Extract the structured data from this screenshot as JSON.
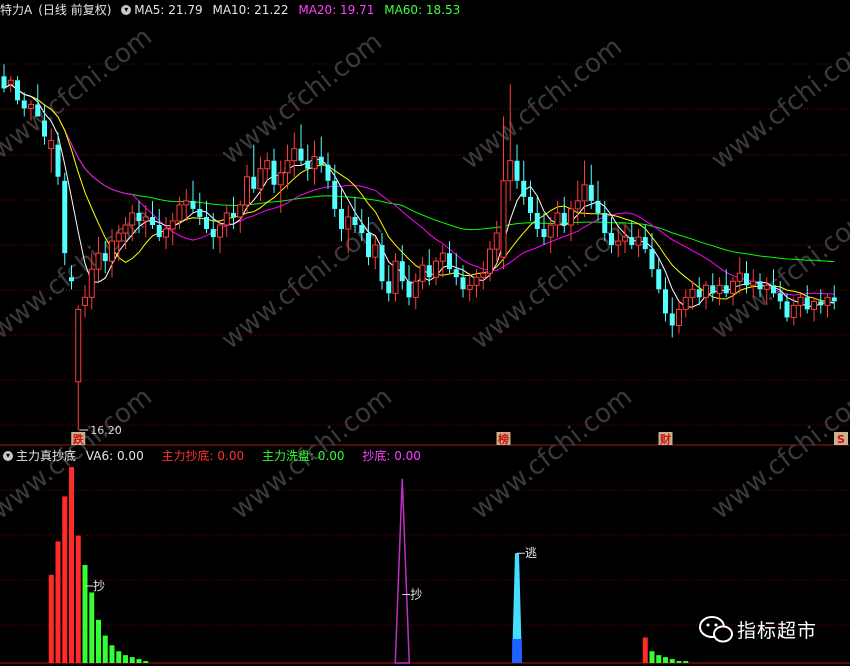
{
  "header_main": {
    "title": "特力A",
    "period": "(日线 前复权)",
    "ma5_label": "MA5: 21.79",
    "ma10_label": "MA10: 21.22",
    "ma20_label": "MA20: 19.71",
    "ma60_label": "MA60: 18.53"
  },
  "header_indicator": {
    "name": "主力真抄底",
    "va6_label": "VA6: 0.00",
    "main_bottom_label": "主力抄底: 0.00",
    "main_wash_label": "主力洗盘: 0.00",
    "bottom_label": "抄底: 0.00"
  },
  "watermark": "www.cfchi.com",
  "brand": {
    "name": "指标超市",
    "icon": "wechat-bubbles-icon"
  },
  "colors": {
    "background": "#000000",
    "up": "#ff3b3b",
    "down": "#54ffff",
    "ma5": "#ffffff",
    "ma10": "#ffff00",
    "ma20": "#ff00ff",
    "ma60": "#00ff00",
    "grid": "#7a0000",
    "indicator_red": "#ff2a2a",
    "indicator_green": "#33ff33",
    "indicator_purple": "#c030c0",
    "indicator_cyan": "#45ddff"
  },
  "chart_data": [
    {
      "type": "candlestick",
      "y_range": [
        16.2,
        26.4
      ],
      "low_annotation": "16.20",
      "markers": [
        {
          "index": 11,
          "text": "跌"
        },
        {
          "index": 74,
          "text": "榜"
        },
        {
          "index": 98,
          "text": "财"
        },
        {
          "index": 124,
          "text": "S"
        }
      ],
      "candles": [
        {
          "o": 25.0,
          "h": 25.3,
          "l": 24.6,
          "c": 24.7
        },
        {
          "o": 24.8,
          "h": 25.0,
          "l": 24.6,
          "c": 24.9
        },
        {
          "o": 24.9,
          "h": 25.0,
          "l": 24.3,
          "c": 24.4
        },
        {
          "o": 24.4,
          "h": 24.6,
          "l": 24.0,
          "c": 24.2
        },
        {
          "o": 24.2,
          "h": 24.4,
          "l": 23.9,
          "c": 24.3
        },
        {
          "o": 24.3,
          "h": 24.8,
          "l": 24.1,
          "c": 24.0
        },
        {
          "o": 23.9,
          "h": 24.3,
          "l": 23.3,
          "c": 23.5
        },
        {
          "o": 23.2,
          "h": 23.7,
          "l": 22.6,
          "c": 23.4
        },
        {
          "o": 23.3,
          "h": 23.6,
          "l": 22.3,
          "c": 22.5
        },
        {
          "o": 22.4,
          "h": 22.6,
          "l": 20.3,
          "c": 20.6
        },
        {
          "o": 20.0,
          "h": 20.3,
          "l": 19.7,
          "c": 19.9
        },
        {
          "o": 17.4,
          "h": 19.3,
          "l": 16.2,
          "c": 19.2
        },
        {
          "o": 19.3,
          "h": 19.8,
          "l": 19.0,
          "c": 19.5
        },
        {
          "o": 19.5,
          "h": 20.6,
          "l": 19.2,
          "c": 20.2
        },
        {
          "o": 20.2,
          "h": 21.0,
          "l": 19.9,
          "c": 20.6
        },
        {
          "o": 20.6,
          "h": 20.9,
          "l": 20.1,
          "c": 20.4
        },
        {
          "o": 20.4,
          "h": 21.2,
          "l": 20.0,
          "c": 20.9
        },
        {
          "o": 20.9,
          "h": 21.3,
          "l": 20.4,
          "c": 21.1
        },
        {
          "o": 21.1,
          "h": 21.5,
          "l": 20.7,
          "c": 21.3
        },
        {
          "o": 21.3,
          "h": 21.8,
          "l": 20.9,
          "c": 21.6
        },
        {
          "o": 21.6,
          "h": 21.9,
          "l": 21.1,
          "c": 21.4
        },
        {
          "o": 21.4,
          "h": 21.8,
          "l": 21.0,
          "c": 21.5
        },
        {
          "o": 21.5,
          "h": 21.9,
          "l": 21.2,
          "c": 21.3
        },
        {
          "o": 21.3,
          "h": 21.7,
          "l": 20.9,
          "c": 21.0
        },
        {
          "o": 21.0,
          "h": 21.5,
          "l": 20.7,
          "c": 21.2
        },
        {
          "o": 21.2,
          "h": 21.6,
          "l": 20.8,
          "c": 21.4
        },
        {
          "o": 21.4,
          "h": 22.0,
          "l": 21.2,
          "c": 21.8
        },
        {
          "o": 21.8,
          "h": 22.2,
          "l": 21.4,
          "c": 21.9
        },
        {
          "o": 21.9,
          "h": 22.4,
          "l": 21.6,
          "c": 21.7
        },
        {
          "o": 21.7,
          "h": 22.1,
          "l": 21.3,
          "c": 21.5
        },
        {
          "o": 21.5,
          "h": 21.9,
          "l": 21.1,
          "c": 21.2
        },
        {
          "o": 21.2,
          "h": 21.6,
          "l": 20.7,
          "c": 21.0
        },
        {
          "o": 21.0,
          "h": 21.4,
          "l": 20.6,
          "c": 21.3
        },
        {
          "o": 21.3,
          "h": 21.8,
          "l": 21.0,
          "c": 21.6
        },
        {
          "o": 21.6,
          "h": 22.0,
          "l": 21.2,
          "c": 21.5
        },
        {
          "o": 21.5,
          "h": 21.9,
          "l": 21.1,
          "c": 21.8
        },
        {
          "o": 21.8,
          "h": 22.8,
          "l": 21.6,
          "c": 22.5
        },
        {
          "o": 22.5,
          "h": 23.3,
          "l": 22.1,
          "c": 22.2
        },
        {
          "o": 22.2,
          "h": 23.0,
          "l": 21.9,
          "c": 22.7
        },
        {
          "o": 22.7,
          "h": 23.1,
          "l": 22.4,
          "c": 22.9
        },
        {
          "o": 22.9,
          "h": 23.2,
          "l": 22.1,
          "c": 22.3
        },
        {
          "o": 22.3,
          "h": 22.9,
          "l": 21.6,
          "c": 22.6
        },
        {
          "o": 22.6,
          "h": 23.3,
          "l": 22.2,
          "c": 22.9
        },
        {
          "o": 22.9,
          "h": 23.6,
          "l": 22.5,
          "c": 23.2
        },
        {
          "o": 23.2,
          "h": 23.8,
          "l": 22.8,
          "c": 22.9
        },
        {
          "o": 22.9,
          "h": 23.3,
          "l": 22.4,
          "c": 22.7
        },
        {
          "o": 22.7,
          "h": 23.4,
          "l": 22.3,
          "c": 23.0
        },
        {
          "o": 23.0,
          "h": 23.5,
          "l": 22.6,
          "c": 22.8
        },
        {
          "o": 22.8,
          "h": 23.1,
          "l": 22.2,
          "c": 22.4
        },
        {
          "o": 22.4,
          "h": 22.8,
          "l": 21.5,
          "c": 21.7
        },
        {
          "o": 21.7,
          "h": 22.2,
          "l": 20.9,
          "c": 21.2
        },
        {
          "o": 21.2,
          "h": 21.8,
          "l": 20.6,
          "c": 21.5
        },
        {
          "o": 21.5,
          "h": 22.0,
          "l": 21.1,
          "c": 21.3
        },
        {
          "o": 21.3,
          "h": 21.7,
          "l": 20.9,
          "c": 21.1
        },
        {
          "o": 21.1,
          "h": 21.5,
          "l": 20.3,
          "c": 20.5
        },
        {
          "o": 20.5,
          "h": 21.0,
          "l": 20.2,
          "c": 20.8
        },
        {
          "o": 20.8,
          "h": 21.1,
          "l": 19.7,
          "c": 19.9
        },
        {
          "o": 19.9,
          "h": 20.3,
          "l": 19.4,
          "c": 19.6
        },
        {
          "o": 19.6,
          "h": 20.6,
          "l": 19.4,
          "c": 20.4
        },
        {
          "o": 20.4,
          "h": 20.8,
          "l": 19.7,
          "c": 19.9
        },
        {
          "o": 19.9,
          "h": 20.3,
          "l": 19.3,
          "c": 19.5
        },
        {
          "o": 19.5,
          "h": 20.1,
          "l": 19.2,
          "c": 19.9
        },
        {
          "o": 19.9,
          "h": 20.5,
          "l": 19.7,
          "c": 20.3
        },
        {
          "o": 20.3,
          "h": 20.7,
          "l": 19.8,
          "c": 20.0
        },
        {
          "o": 20.0,
          "h": 20.5,
          "l": 19.8,
          "c": 20.4
        },
        {
          "o": 20.4,
          "h": 20.8,
          "l": 20.0,
          "c": 20.6
        },
        {
          "o": 20.6,
          "h": 20.9,
          "l": 20.1,
          "c": 20.2
        },
        {
          "o": 20.2,
          "h": 20.6,
          "l": 19.8,
          "c": 20.0
        },
        {
          "o": 20.0,
          "h": 20.3,
          "l": 19.5,
          "c": 19.7
        },
        {
          "o": 19.7,
          "h": 20.1,
          "l": 19.4,
          "c": 19.8
        },
        {
          "o": 19.8,
          "h": 20.2,
          "l": 19.5,
          "c": 20.0
        },
        {
          "o": 20.0,
          "h": 20.4,
          "l": 19.7,
          "c": 20.1
        },
        {
          "o": 20.1,
          "h": 20.9,
          "l": 19.9,
          "c": 20.7
        },
        {
          "o": 20.7,
          "h": 21.4,
          "l": 20.4,
          "c": 21.1
        },
        {
          "o": 20.5,
          "h": 24.0,
          "l": 20.2,
          "c": 22.4
        },
        {
          "o": 22.4,
          "h": 24.8,
          "l": 21.9,
          "c": 22.9
        },
        {
          "o": 22.9,
          "h": 23.3,
          "l": 22.2,
          "c": 22.4
        },
        {
          "o": 22.4,
          "h": 22.9,
          "l": 21.8,
          "c": 22.0
        },
        {
          "o": 22.0,
          "h": 22.4,
          "l": 21.4,
          "c": 21.6
        },
        {
          "o": 21.6,
          "h": 22.0,
          "l": 21.0,
          "c": 21.2
        },
        {
          "o": 21.2,
          "h": 21.6,
          "l": 20.8,
          "c": 21.0
        },
        {
          "o": 21.0,
          "h": 21.5,
          "l": 20.6,
          "c": 21.3
        },
        {
          "o": 21.3,
          "h": 21.9,
          "l": 21.0,
          "c": 21.6
        },
        {
          "o": 21.6,
          "h": 22.0,
          "l": 21.1,
          "c": 21.3
        },
        {
          "o": 21.3,
          "h": 21.9,
          "l": 20.9,
          "c": 21.7
        },
        {
          "o": 21.7,
          "h": 22.4,
          "l": 21.3,
          "c": 21.9
        },
        {
          "o": 21.9,
          "h": 22.9,
          "l": 21.5,
          "c": 22.3
        },
        {
          "o": 22.3,
          "h": 22.8,
          "l": 21.7,
          "c": 21.9
        },
        {
          "o": 21.9,
          "h": 22.4,
          "l": 21.4,
          "c": 21.6
        },
        {
          "o": 21.6,
          "h": 21.9,
          "l": 20.9,
          "c": 21.1
        },
        {
          "o": 21.1,
          "h": 21.5,
          "l": 20.6,
          "c": 20.8
        },
        {
          "o": 20.8,
          "h": 21.2,
          "l": 20.5,
          "c": 20.9
        },
        {
          "o": 20.9,
          "h": 21.3,
          "l": 20.6,
          "c": 21.0
        },
        {
          "o": 21.0,
          "h": 21.4,
          "l": 20.7,
          "c": 20.8
        },
        {
          "o": 20.8,
          "h": 21.2,
          "l": 20.5,
          "c": 21.0
        },
        {
          "o": 21.0,
          "h": 21.3,
          "l": 20.6,
          "c": 20.7
        },
        {
          "o": 20.7,
          "h": 21.1,
          "l": 20.0,
          "c": 20.2
        },
        {
          "o": 20.2,
          "h": 20.5,
          "l": 19.6,
          "c": 19.7
        },
        {
          "o": 19.7,
          "h": 20.0,
          "l": 18.9,
          "c": 19.1
        },
        {
          "o": 19.1,
          "h": 19.5,
          "l": 18.5,
          "c": 18.8
        },
        {
          "o": 18.8,
          "h": 19.4,
          "l": 18.6,
          "c": 19.2
        },
        {
          "o": 19.2,
          "h": 19.7,
          "l": 19.0,
          "c": 19.5
        },
        {
          "o": 19.5,
          "h": 19.9,
          "l": 19.2,
          "c": 19.7
        },
        {
          "o": 19.7,
          "h": 20.0,
          "l": 19.3,
          "c": 19.5
        },
        {
          "o": 19.5,
          "h": 19.9,
          "l": 19.2,
          "c": 19.8
        },
        {
          "o": 19.8,
          "h": 20.1,
          "l": 19.4,
          "c": 19.6
        },
        {
          "o": 19.6,
          "h": 20.0,
          "l": 19.3,
          "c": 19.8
        },
        {
          "o": 19.8,
          "h": 20.2,
          "l": 19.5,
          "c": 19.6
        },
        {
          "o": 19.6,
          "h": 20.0,
          "l": 19.3,
          "c": 19.9
        },
        {
          "o": 19.9,
          "h": 20.5,
          "l": 19.6,
          "c": 20.1
        },
        {
          "o": 20.1,
          "h": 20.4,
          "l": 19.6,
          "c": 19.8
        },
        {
          "o": 19.8,
          "h": 20.2,
          "l": 19.5,
          "c": 19.9
        },
        {
          "o": 19.9,
          "h": 20.1,
          "l": 19.5,
          "c": 19.7
        },
        {
          "o": 19.7,
          "h": 20.0,
          "l": 19.3,
          "c": 19.8
        },
        {
          "o": 19.8,
          "h": 20.2,
          "l": 19.5,
          "c": 19.6
        },
        {
          "o": 19.6,
          "h": 19.9,
          "l": 19.2,
          "c": 19.4
        },
        {
          "o": 19.4,
          "h": 19.6,
          "l": 18.9,
          "c": 19.0
        },
        {
          "o": 19.0,
          "h": 19.5,
          "l": 18.8,
          "c": 19.3
        },
        {
          "o": 19.3,
          "h": 19.6,
          "l": 19.0,
          "c": 19.5
        },
        {
          "o": 19.5,
          "h": 19.8,
          "l": 19.1,
          "c": 19.2
        },
        {
          "o": 19.2,
          "h": 19.5,
          "l": 18.9,
          "c": 19.4
        },
        {
          "o": 19.4,
          "h": 19.7,
          "l": 19.1,
          "c": 19.3
        },
        {
          "o": 19.3,
          "h": 19.6,
          "l": 19.0,
          "c": 19.5
        },
        {
          "o": 19.5,
          "h": 19.8,
          "l": 19.2,
          "c": 19.4
        }
      ]
    },
    {
      "type": "bar",
      "name": "主力真抄底",
      "markers": [
        {
          "index": 12,
          "text": "抄"
        },
        {
          "index": 59,
          "text": "抄"
        },
        {
          "index": 76,
          "text": "逃"
        }
      ],
      "bars": [
        {
          "index": 7,
          "value": 0.45,
          "color": "red"
        },
        {
          "index": 8,
          "value": 0.62,
          "color": "red"
        },
        {
          "index": 9,
          "value": 0.85,
          "color": "red"
        },
        {
          "index": 10,
          "value": 1.0,
          "color": "red"
        },
        {
          "index": 11,
          "value": 0.65,
          "color": "red"
        },
        {
          "index": 12,
          "value": 0.5,
          "color": "green"
        },
        {
          "index": 13,
          "value": 0.36,
          "color": "green"
        },
        {
          "index": 14,
          "value": 0.22,
          "color": "green"
        },
        {
          "index": 15,
          "value": 0.14,
          "color": "green"
        },
        {
          "index": 16,
          "value": 0.09,
          "color": "green"
        },
        {
          "index": 17,
          "value": 0.06,
          "color": "green"
        },
        {
          "index": 18,
          "value": 0.04,
          "color": "green"
        },
        {
          "index": 19,
          "value": 0.03,
          "color": "green"
        },
        {
          "index": 20,
          "value": 0.02,
          "color": "green"
        },
        {
          "index": 21,
          "value": 0.01,
          "color": "green"
        },
        {
          "index": 95,
          "value": 0.13,
          "color": "red"
        },
        {
          "index": 96,
          "value": 0.06,
          "color": "green"
        },
        {
          "index": 97,
          "value": 0.04,
          "color": "green"
        },
        {
          "index": 98,
          "value": 0.03,
          "color": "green"
        },
        {
          "index": 99,
          "value": 0.02,
          "color": "green"
        },
        {
          "index": 100,
          "value": 0.01,
          "color": "green"
        },
        {
          "index": 101,
          "value": 0.01,
          "color": "green"
        }
      ],
      "spikes": [
        {
          "index": 59,
          "value": 0.94,
          "color": "purple"
        },
        {
          "index": 76,
          "value": 0.56,
          "color": "cyan"
        }
      ]
    }
  ]
}
